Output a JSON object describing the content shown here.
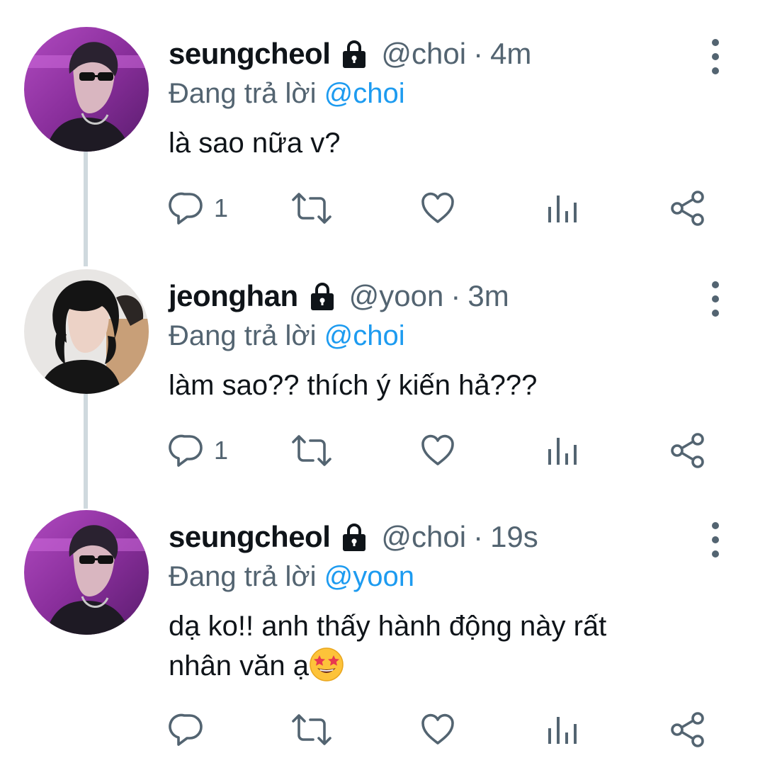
{
  "colors": {
    "text": "#0f1419",
    "secondary": "#536471",
    "accent": "#1d9bf0",
    "thread_line": "#cfd9de"
  },
  "tweets": [
    {
      "display_name": "seungcheol",
      "handle": "@choi",
      "separator": "·",
      "time": "4m",
      "reply_prefix": "Đang trả lời",
      "reply_to": "@choi",
      "text": "là sao nữa v?",
      "reply_count": "1",
      "avatar": "avatar-seungcheol",
      "icons": [
        "lock-icon",
        "more-icon",
        "reply-icon",
        "retweet-icon",
        "like-icon",
        "analytics-icon",
        "share-icon"
      ]
    },
    {
      "display_name": "jeonghan",
      "handle": "@yoon",
      "separator": "·",
      "time": "3m",
      "reply_prefix": "Đang trả lời",
      "reply_to": "@choi",
      "text": "làm sao?? thích ý kiến hả???",
      "reply_count": "1",
      "avatar": "avatar-jeonghan",
      "icons": [
        "lock-icon",
        "more-icon",
        "reply-icon",
        "retweet-icon",
        "like-icon",
        "analytics-icon",
        "share-icon"
      ]
    },
    {
      "display_name": "seungcheol",
      "handle": "@choi",
      "separator": "·",
      "time": "19s",
      "reply_prefix": "Đang trả lời",
      "reply_to": "@yoon",
      "text_line1": "dạ ko!! anh thấy hành động này rất",
      "text_line2": "nhân văn ạ",
      "emoji": "star-struck-emoji",
      "reply_count": "",
      "avatar": "avatar-seungcheol",
      "icons": [
        "lock-icon",
        "more-icon",
        "reply-icon",
        "retweet-icon",
        "like-icon",
        "analytics-icon",
        "share-icon"
      ]
    }
  ]
}
